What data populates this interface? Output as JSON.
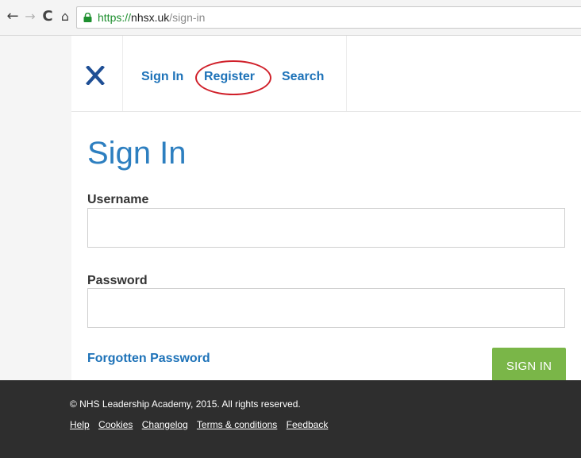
{
  "browser": {
    "url_scheme": "https://",
    "url_host": "nhsx.uk",
    "url_path": "/sign-in",
    "back_glyph": "←",
    "forward_glyph": "→",
    "reload_glyph": "C",
    "home_glyph": "⌂",
    "secure_icon": "lock-icon"
  },
  "header": {
    "logo_icon": "x-logo-icon",
    "nav": {
      "sign_in": "Sign In",
      "register": "Register",
      "search": "Search"
    },
    "highlighted_item": "register"
  },
  "form": {
    "title": "Sign In",
    "username_label": "Username",
    "username_value": "",
    "password_label": "Password",
    "password_value": "",
    "forgot_link": "Forgotten Password",
    "submit_label": "SIGN IN"
  },
  "footer": {
    "copyright": "© NHS Leadership Academy, 2015. All rights reserved.",
    "links": {
      "help": "Help",
      "cookies": "Cookies",
      "changelog": "Changelog",
      "terms": "Terms & conditions",
      "feedback": "Feedback"
    }
  },
  "colors": {
    "brand_blue": "#2d7fc0",
    "link_blue": "#1d72b8",
    "button_green": "#7ab648",
    "highlight_red": "#d0202a",
    "footer_bg": "#2e2e2e"
  }
}
